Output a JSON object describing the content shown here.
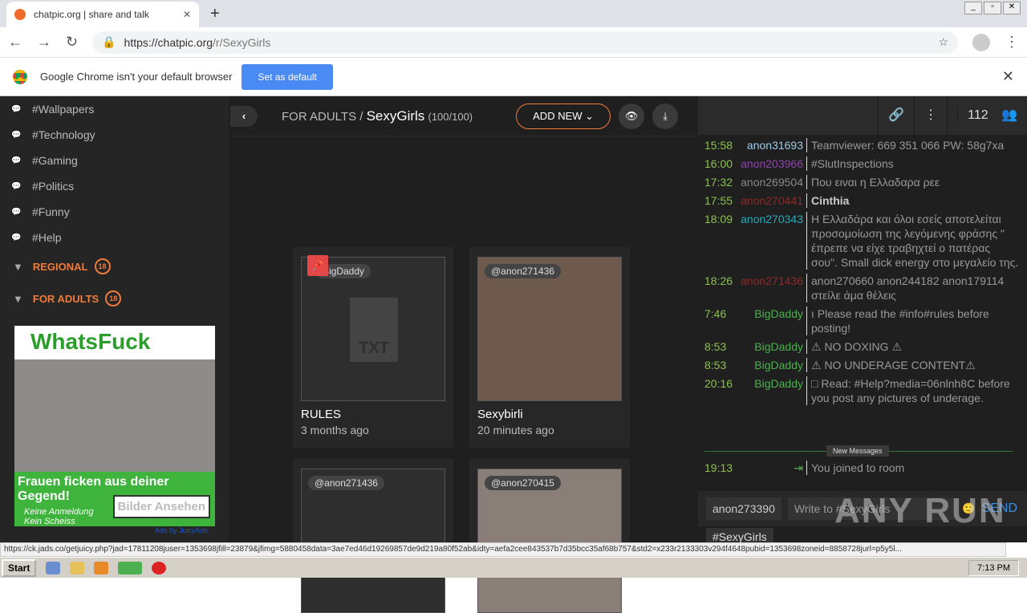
{
  "browser": {
    "tab_title": "chatpic.org | share and talk",
    "url_host": "https://chatpic.org",
    "url_path": "/r/SexyGirls"
  },
  "infobar": {
    "message": "Google Chrome isn't your default browser",
    "button": "Set as default"
  },
  "sidebar": {
    "items": [
      {
        "label": "#Wallpapers"
      },
      {
        "label": "#Technology"
      },
      {
        "label": "#Gaming"
      },
      {
        "label": "#Politics"
      },
      {
        "label": "#Funny"
      },
      {
        "label": "#Help"
      }
    ],
    "groups": [
      {
        "label": "REGIONAL",
        "badge": "18"
      },
      {
        "label": "FOR ADULTS",
        "badge": "18"
      }
    ],
    "ad": {
      "title": "WhatsFuck",
      "tagline": "Frauen ficken aus deiner Gegend!",
      "sub": "Keine Anmeldung Kein Scheiss",
      "button": "Bilder Ansehen",
      "adsby": "Ads by JuicyAds"
    }
  },
  "main": {
    "crumb_parent": "FOR ADULTS /",
    "room": "SexyGirls",
    "count": "(100/100)",
    "add_new": "ADD NEW",
    "cards": [
      {
        "tag": "BigDaddy",
        "name": "RULES",
        "when": "3 months ago",
        "type": "txt"
      },
      {
        "tag": "@anon271436",
        "name": "Sexybirli",
        "when": "20 minutes ago",
        "type": "image"
      },
      {
        "tag": "@anon271436",
        "name": "",
        "when": "",
        "type": "image"
      },
      {
        "tag": "@anon270415",
        "name": "",
        "when": "",
        "type": "image"
      }
    ]
  },
  "chat": {
    "user_count": "112",
    "messages": [
      {
        "time": "15:58",
        "user": "anon31693",
        "user_color": "#9ecbe8",
        "text": "Teamviewer: 669 351 066 PW: 58g7xa",
        "cls": ""
      },
      {
        "time": "16:00",
        "user": "anon203966",
        "user_color": "#8e44ad",
        "text": "#SlutInspections",
        "cls": "orange"
      },
      {
        "time": "17:32",
        "user": "anon269504",
        "user_color": "#888888",
        "text": "Που ειναι η Ελλαδαρα ρεε",
        "cls": ""
      },
      {
        "time": "17:55",
        "user": "anon270441",
        "user_color": "#8b2a2a",
        "text": "Cinthia",
        "cls": "bold"
      },
      {
        "time": "18:09",
        "user": "anon270343",
        "user_color": "#26a9b8",
        "text": "Η Ελλαδάρα και όλοι εσείς αποτελείται προσομοίωση της λεγόμενης φράσης \" έπρεπε να είχε τραβηχτεί ο πατέρας σου\". Small dick energy στο μεγαλείο της.",
        "cls": ""
      },
      {
        "time": "18:26",
        "user": "anon271436",
        "user_color": "#8b2a2a",
        "text": "anon270660 anon244182 anon179114 στείλε άμα θέλεις",
        "cls": ""
      },
      {
        "time": "7:46",
        "user": "BigDaddy",
        "user_color": "#4caf50",
        "text": "ı Please read the #info#rules before posting!",
        "cls": "green"
      },
      {
        "time": "8:53",
        "user": "BigDaddy",
        "user_color": "#4caf50",
        "text": "⚠ NO DOXING ⚠",
        "cls": "green"
      },
      {
        "time": "8:53",
        "user": "BigDaddy",
        "user_color": "#4caf50",
        "text": "⚠ NO UNDERAGE CONTENT⚠",
        "cls": "green"
      },
      {
        "time": "20:16",
        "user": "BigDaddy",
        "user_color": "#4caf50",
        "text": "□ Read: #Help?media=06nlnh8C before you post any pictures of underage.",
        "cls": "green"
      }
    ],
    "new_messages": "New Messages",
    "joined": {
      "time": "19:13",
      "text": "You joined to room"
    },
    "nick": "anon273390",
    "placeholder": "Write to #SexyGirls",
    "send": "SEND",
    "room_tag": "#SexyGirls"
  },
  "statusbar": "https://ck.jads.co/getjuicy.php?jad=17811208juser=1353698jfill=23879&jfimg=5880458data=3ae7ed46d19269857de9d219a80f52ab&idty=aefa2cee843537b7d35bcc35af68b757&std2=x233r2133303v294f4648pubid=1353698zoneid=8858728jurl=p5y5l...",
  "taskbar": {
    "start": "Start",
    "clock": "7:13 PM"
  },
  "watermark": "ANY RUN"
}
